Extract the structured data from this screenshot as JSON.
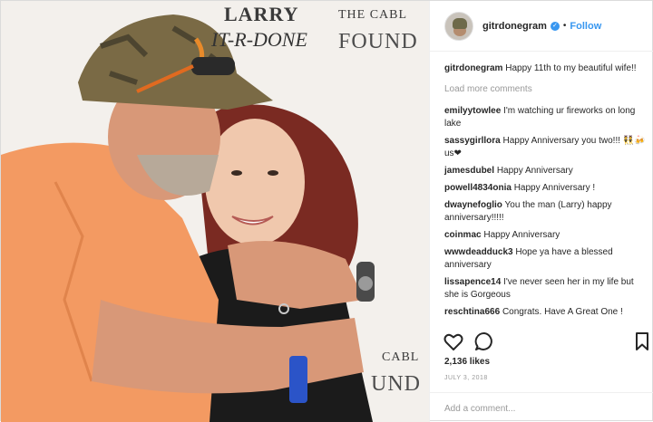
{
  "photo": {
    "backdrop_text": {
      "larry": "LARRY",
      "the_cable": "THE CABL",
      "gitr_done": "IT-R-DONE",
      "foundation": "FOUND",
      "cable_lower": "CABL",
      "foundation_lower": "UND"
    }
  },
  "header": {
    "username": "gitrdonegram",
    "separator": "•",
    "follow_label": "Follow"
  },
  "caption": {
    "user": "gitrdonegram",
    "text": "Happy 11th to my beautiful wife!!"
  },
  "load_more_label": "Load more comments",
  "comments": [
    {
      "user": "emilyytowlee",
      "text": "I'm watching ur fireworks on long lake"
    },
    {
      "user": "sassygirllora",
      "text": "Happy Anniversary you two!!! 👯🍻us❤"
    },
    {
      "user": "jamesdubel",
      "text": "Happy Anniversary"
    },
    {
      "user": "powell4834onia",
      "text": "Happy Anniversary !"
    },
    {
      "user": "dwaynefoglio",
      "text": "You the man (Larry) happy anniversary!!!!!"
    },
    {
      "user": "coinmac",
      "text": "Happy Anniversary"
    },
    {
      "user": "wwwdeadduck3",
      "text": "Hope ya have a blessed anniversary"
    },
    {
      "user": "lissapence14",
      "text": "I've never seen her in my life but she is Gorgeous"
    },
    {
      "user": "reschtina666",
      "text": "Congrats. Have A Great One !"
    }
  ],
  "likes": "2,136 likes",
  "date": "JULY 3, 2018",
  "add_comment_placeholder": "Add a comment...",
  "icons": {
    "like": "heart-icon",
    "comment": "comment-icon",
    "save": "bookmark-icon",
    "verified": "verified-badge-icon"
  },
  "colors": {
    "link_blue": "#3897f0",
    "muted": "#999999",
    "text": "#262626",
    "shirt_orange": "#f39a62"
  }
}
